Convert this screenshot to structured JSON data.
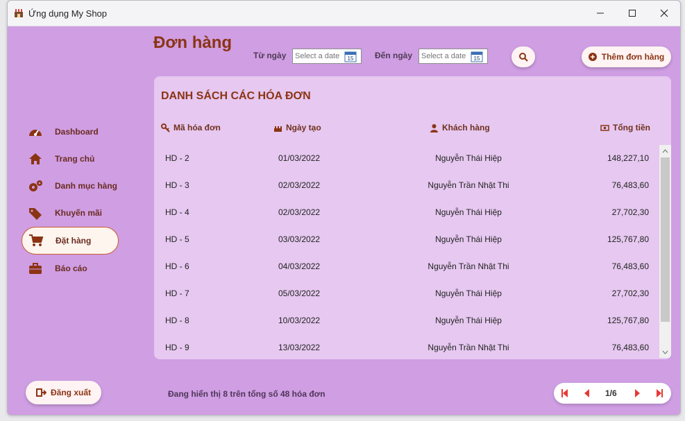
{
  "window": {
    "title": "Ứng dụng My Shop"
  },
  "header": {
    "page_title": "Đơn hàng",
    "from_label": "Từ ngày",
    "from_placeholder": "Select a date",
    "to_label": "Đến ngày",
    "to_placeholder": "Select a date",
    "search_icon": "search-icon",
    "add_order_label": "Thêm đơn hàng"
  },
  "sidebar": {
    "items": [
      {
        "label": "Dashboard",
        "icon": "dashboard-icon"
      },
      {
        "label": "Trang chủ",
        "icon": "home-icon"
      },
      {
        "label": "Danh mục hàng",
        "icon": "gears-icon"
      },
      {
        "label": "Khuyến mãi",
        "icon": "tags-icon"
      },
      {
        "label": "Đặt hàng",
        "icon": "cart-icon"
      },
      {
        "label": "Báo cáo",
        "icon": "briefcase-icon"
      }
    ],
    "logout_label": "Đăng xuất"
  },
  "invoice_list": {
    "title": "DANH SÁCH CÁC HÓA ĐƠN",
    "columns": [
      "Mã hóa đơn",
      "Ngày tạo",
      "Khách hàng",
      "Tổng tiền"
    ],
    "rows": [
      {
        "id": "HD - 2",
        "date": "01/03/2022",
        "customer": "Nguyễn Thái Hiệp",
        "total": "148,227,10"
      },
      {
        "id": "HD - 3",
        "date": "02/03/2022",
        "customer": "Nguyễn Trần Nhật Thi",
        "total": "76,483,60"
      },
      {
        "id": "HD - 4",
        "date": "02/03/2022",
        "customer": "Nguyễn Thái Hiệp",
        "total": "27,702,30"
      },
      {
        "id": "HD - 5",
        "date": "03/03/2022",
        "customer": "Nguyễn Thái Hiệp",
        "total": "125,767,80"
      },
      {
        "id": "HD - 6",
        "date": "04/03/2022",
        "customer": "Nguyễn Trần Nhật Thi",
        "total": "76,483,60"
      },
      {
        "id": "HD - 7",
        "date": "05/03/2022",
        "customer": "Nguyễn Thái Hiệp",
        "total": "27,702,30"
      },
      {
        "id": "HD - 8",
        "date": "10/03/2022",
        "customer": "Nguyễn Thái Hiệp",
        "total": "125,767,80"
      },
      {
        "id": "HD - 9",
        "date": "13/03/2022",
        "customer": "Nguyễn Trần Nhật Thi",
        "total": "76,483,60"
      }
    ]
  },
  "footer": {
    "status_text": "Đang hiển thị 8 trên tổng số 48 hóa đơn",
    "page_indicator": "1/6"
  },
  "colors": {
    "brand": "#8b3414",
    "background": "#cf9ee3",
    "panel": "#e6c8f0",
    "pager_red": "#e53935"
  }
}
